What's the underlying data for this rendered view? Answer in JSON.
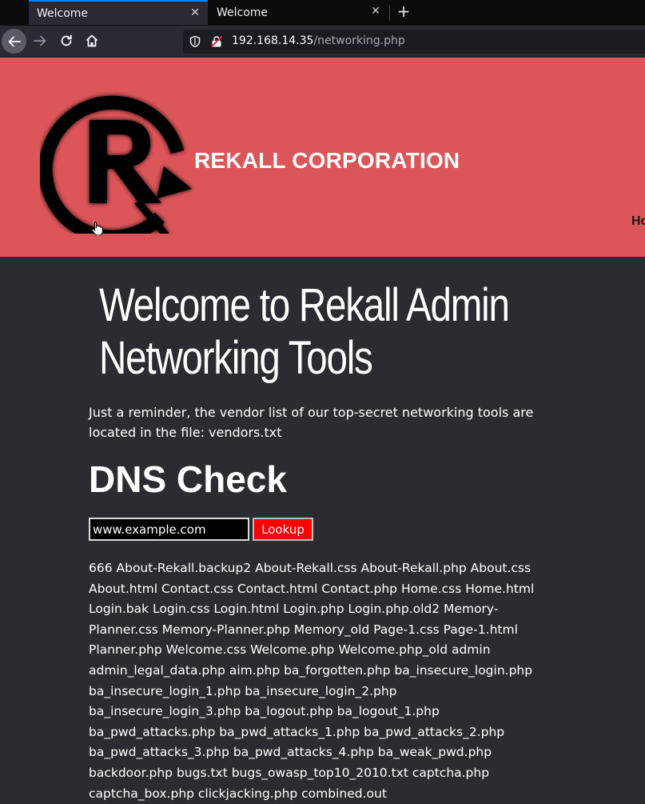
{
  "browser": {
    "tabs": [
      {
        "title": "Welcome",
        "active": true
      },
      {
        "title": "Welcome",
        "active": false
      }
    ],
    "close_glyph": "✕",
    "newtab_glyph": "+",
    "url_host": "192.168.14.35",
    "url_path": "/networking.php"
  },
  "header": {
    "brand": "REKALL CORPORATION",
    "nav_peek": "Ho",
    "background": "#dc5559"
  },
  "main": {
    "title_line1": "Welcome to Rekall Admin",
    "title_line2": "Networking Tools",
    "reminder": "Just a reminder, the vendor list of our top-secret networking tools are located in the file: vendors.txt",
    "dns_heading": "DNS Check",
    "dns_input_value": "www.example.com",
    "lookup_label": "Lookup",
    "results": "666 About-Rekall.backup2 About-Rekall.css About-Rekall.php About.css About.html Contact.css Contact.html Contact.php Home.css Home.html Login.bak Login.css Login.html Login.php Login.php.old2 Memory-Planner.css Memory-Planner.php Memory_old Page-1.css Page-1.html Planner.php Welcome.css Welcome.php Welcome.php_old admin admin_legal_data.php aim.php ba_forgotten.php ba_insecure_login.php ba_insecure_login_1.php ba_insecure_login_2.php ba_insecure_login_3.php ba_logout.php ba_logout_1.php ba_pwd_attacks.php ba_pwd_attacks_1.php ba_pwd_attacks_2.php ba_pwd_attacks_3.php ba_pwd_attacks_4.php ba_weak_pwd.php backdoor.php bugs.txt bugs_owasp_top10_2010.txt captcha.php captcha_box.php clickjacking.php combined.out"
  },
  "colors": {
    "page_bg": "#2a2c31",
    "accent_tab": "#0a84ff",
    "lookup_bg": "#ff0000"
  }
}
